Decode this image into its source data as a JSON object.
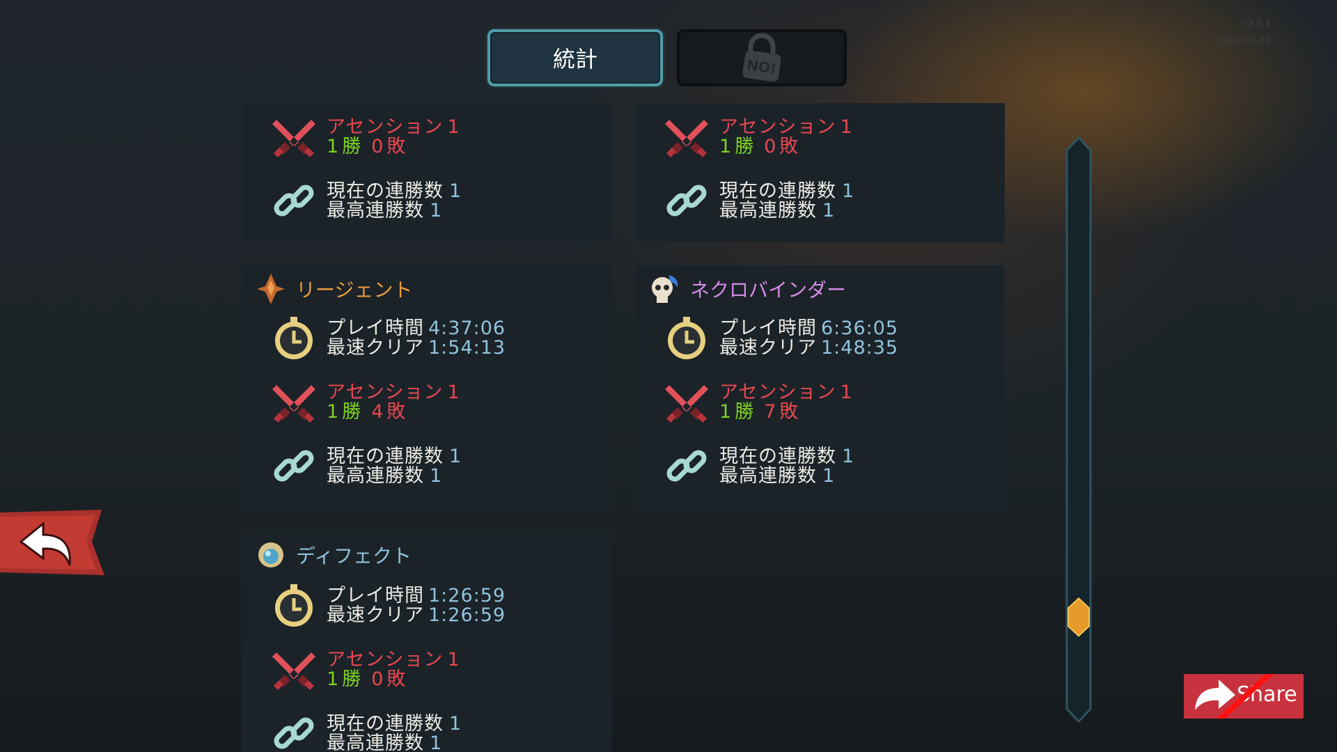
{
  "tabs": {
    "stats_label": "統計",
    "locked_label": "NO!"
  },
  "version": {
    "line1": "v2.0.1",
    "line2": "2020-03-07"
  },
  "labels": {
    "ascension": "アセンション",
    "wins_suffix": "勝",
    "losses_suffix": "敗",
    "current_streak": "現在の連勝数",
    "best_streak": "最高連勝数",
    "play_time": "プレイ時間",
    "fastest_clear": "最速クリア"
  },
  "panels": {
    "top_left": {
      "ascension_level": "1",
      "wins": "1",
      "losses": "0",
      "current_streak": "1",
      "best_streak": "1"
    },
    "top_right": {
      "ascension_level": "1",
      "wins": "1",
      "losses": "0",
      "current_streak": "1",
      "best_streak": "1"
    },
    "regent": {
      "name": "リージェント",
      "play_time": "4:37:06",
      "fastest_clear": "1:54:13",
      "ascension_level": "1",
      "wins": "1",
      "losses": "4",
      "current_streak": "1",
      "best_streak": "1"
    },
    "necrobinder": {
      "name": "ネクロバインダー",
      "play_time": "6:36:05",
      "fastest_clear": "1:48:35",
      "ascension_level": "1",
      "wins": "1",
      "losses": "7",
      "current_streak": "1",
      "best_streak": "1"
    },
    "defect": {
      "name": "ディフェクト",
      "play_time": "1:26:59",
      "fastest_clear": "1:26:59",
      "ascension_level": "1",
      "wins": "1",
      "losses": "0",
      "current_streak": "1",
      "best_streak": "1"
    }
  },
  "share": {
    "label": "Share"
  },
  "colors": {
    "regent_name": "#e89a3c",
    "necrobinder_name": "#d58ae8",
    "defect_name": "#8fc3dd",
    "ascension": "#e8474f",
    "wins": "#7ed321",
    "value": "#8fc3dd"
  },
  "scroll": {
    "position_fraction": 0.86
  },
  "icons": {
    "back": "back-arrow-icon",
    "swords": "crossed-swords-icon",
    "chain": "chain-link-icon",
    "clock": "stopwatch-icon",
    "lock": "padlock-icon"
  }
}
